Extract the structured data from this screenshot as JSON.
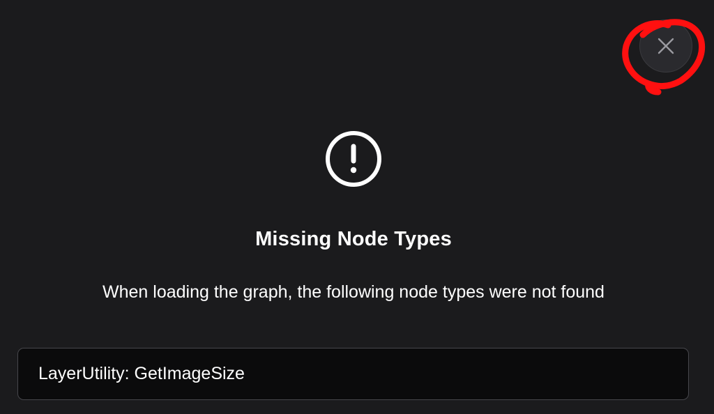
{
  "dialog": {
    "title": "Missing Node Types",
    "message": "When loading the graph, the following node types were not found",
    "missing_nodes": [
      "LayerUtility: GetImageSize"
    ],
    "icons": {
      "close": "close-icon",
      "alert": "alert-circle-icon"
    },
    "colors": {
      "background": "#1b1b1d",
      "list_background": "#0b0b0c",
      "annotation": "#ff0000"
    }
  }
}
